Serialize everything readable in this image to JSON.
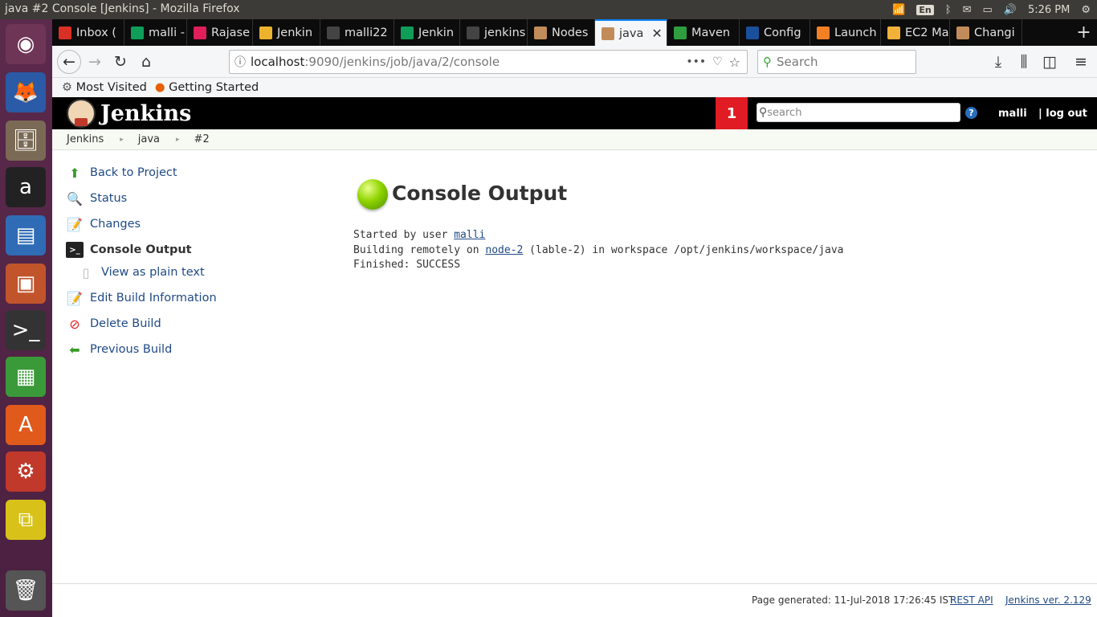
{
  "os": {
    "window_title": "java #2 Console [Jenkins] - Mozilla Firefox",
    "keyboard": "En",
    "clock": "5:26 PM"
  },
  "tabs": [
    {
      "label": "Inbox (",
      "icon": "gmail-icon",
      "color": "#d93025"
    },
    {
      "label": "malli -",
      "icon": "sheets-icon",
      "color": "#0f9d58"
    },
    {
      "label": "Rajase",
      "icon": "hash-icon",
      "color": "#e01e5a"
    },
    {
      "label": "Jenkin",
      "icon": "slack-icon",
      "color": "#ecb22e"
    },
    {
      "label": "malli22",
      "icon": "github-icon",
      "color": "#444444"
    },
    {
      "label": "Jenkin",
      "icon": "sheets-icon",
      "color": "#0f9d58"
    },
    {
      "label": "jenkins",
      "icon": "github-icon",
      "color": "#444444"
    },
    {
      "label": "Nodes",
      "icon": "jenkins-icon",
      "color": "#c28c5a"
    },
    {
      "label": "java",
      "icon": "jenkins-icon",
      "color": "#c28c5a",
      "active": true
    },
    {
      "label": "Maven",
      "icon": "maven-cube-icon",
      "color": "#2e9e3e"
    },
    {
      "label": "Config",
      "icon": "config-icon",
      "color": "#1a4f9c"
    },
    {
      "label": "Launch",
      "icon": "stackoverflow-icon",
      "color": "#f48024"
    },
    {
      "label": "EC2 Ma",
      "icon": "aws-box-icon",
      "color": "#f2b23a"
    },
    {
      "label": "Changi",
      "icon": "jenkins-icon",
      "color": "#c28c5a"
    }
  ],
  "navbar": {
    "url_host": "localhost",
    "url_path": ":9090/jenkins/job/java/2/console",
    "search_placeholder": "Search"
  },
  "bookmarks": [
    {
      "label": "Most Visited",
      "icon": "gear-icon"
    },
    {
      "label": "Getting Started",
      "icon": "firefox-icon"
    }
  ],
  "jenkins": {
    "logo_text": "Jenkins",
    "notification_count": "1",
    "search_placeholder": "search",
    "user": "malli",
    "logout": "| log out"
  },
  "breadcrumb": [
    "Jenkins",
    "java",
    "#2"
  ],
  "sidebar": [
    {
      "label": "Back to Project",
      "icon": "up-arrow-icon"
    },
    {
      "label": "Status",
      "icon": "magnifier-icon"
    },
    {
      "label": "Changes",
      "icon": "notepad-icon"
    },
    {
      "label": "Console Output",
      "icon": "terminal-icon",
      "current": true
    },
    {
      "label": "View as plain text",
      "icon": "document-icon",
      "sub": true
    },
    {
      "label": "Edit Build Information",
      "icon": "notepad-icon"
    },
    {
      "label": "Delete Build",
      "icon": "no-entry-icon"
    },
    {
      "label": "Previous Build",
      "icon": "left-arrow-icon"
    }
  ],
  "main": {
    "heading": "Console Output",
    "status_color": "#8fd400",
    "console": {
      "line1_prefix": "Started by user ",
      "line1_link": "malli",
      "line2_prefix": "Building remotely on ",
      "line2_link": "node-2",
      "line2_suffix": " (lable-2) in workspace /opt/jenkins/workspace/java",
      "line3": "Finished: SUCCESS"
    }
  },
  "footer": {
    "generated": "Page generated: 11-Jul-2018 17:26:45 IST",
    "rest_api": "REST API",
    "version": "Jenkins ver. 2.129"
  }
}
